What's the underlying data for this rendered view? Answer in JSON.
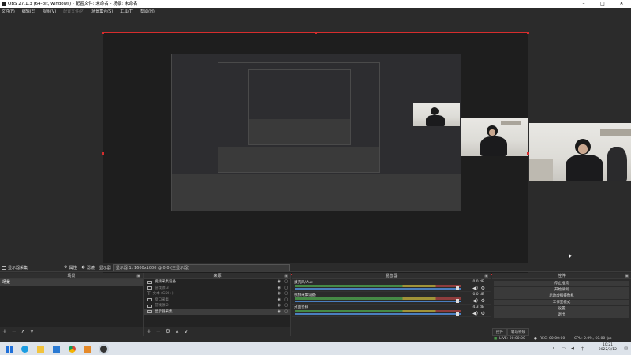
{
  "window": {
    "title": "OBS 27.1.3 (64-bit, windows) - 配置文件: 未命名 - 场景: 未命名",
    "minimize": "–",
    "maximize": "□",
    "close": "✕"
  },
  "menu": [
    "文件(F)",
    "编辑(E)",
    "视图(V)",
    "配置文件(P)",
    "场景集合(S)",
    "工具(T)",
    "帮助(H)"
  ],
  "source_toolbar": {
    "current_source": "显示器采集",
    "properties": "属性",
    "filters": "滤镜",
    "display_label": "显示器",
    "display_value": "显示器 1: 1600x1000 @ 0,0 (主显示器)"
  },
  "docks": {
    "scenes": {
      "title": "场景",
      "items": [
        "场景"
      ]
    },
    "sources": {
      "title": "来源",
      "items": [
        {
          "label": "视频采集设备",
          "dim": false
        },
        {
          "label": "游戏源 3",
          "dim": true
        },
        {
          "label": "文本 (GDI+)",
          "dim": true
        },
        {
          "label": "窗口采集",
          "dim": true
        },
        {
          "label": "游戏源 2",
          "dim": true
        },
        {
          "label": "显示器采集",
          "dim": false
        }
      ]
    },
    "mixer": {
      "title": "混音器",
      "channels": [
        {
          "name": "麦克风/Aux",
          "db": "0.0 dB"
        },
        {
          "name": "视频采集设备",
          "db": "0.0 dB"
        },
        {
          "name": "桌面音频",
          "db": "-4.3 dB"
        }
      ]
    },
    "controls": {
      "title": "控件",
      "buttons": [
        "停止推流",
        "开始录制",
        "启动虚拟摄像机",
        "工作室模式",
        "设置",
        "退出"
      ],
      "tabs": [
        "控件",
        "转场特效"
      ]
    }
  },
  "footer_icons": {
    "add": "+",
    "remove": "−",
    "up": "∧",
    "down": "∨",
    "gear": "⚙"
  },
  "status": {
    "live": "LIVE: 00:00:00",
    "rec": "REC: 00:00:00",
    "cpu": "CPU: 2.0%, 60.00 fps"
  },
  "taskbar": {
    "time": "10:21",
    "date": "2022/3/12"
  },
  "colors": {
    "accent": "#d62d2d",
    "background": "#2b2b2b",
    "taskbar": "#dde3ea"
  }
}
